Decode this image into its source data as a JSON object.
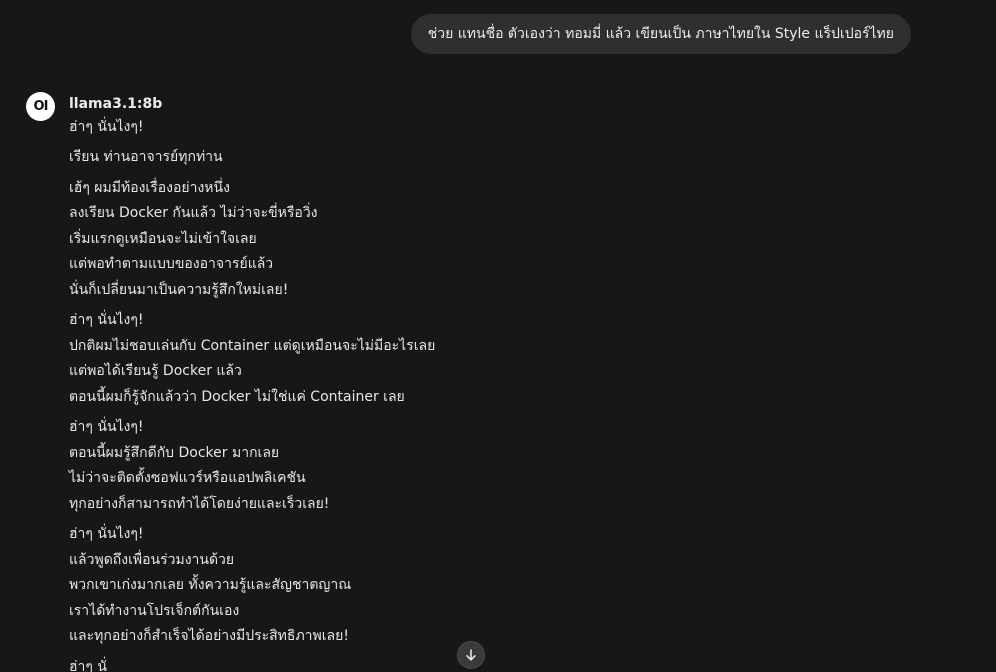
{
  "user_message": "ช่วย แทนชื่อ ตัวเองว่า ทอมมี่ แล้ว เขียนเป็น ภาษาไทยใน Style แร็ปเปอร์ไทย",
  "assistant": {
    "avatar_text": "OI",
    "model_name": "llama3.1:8b",
    "paragraphs": [
      [
        "ฮ่าๆ นั่นไงๆ!"
      ],
      [
        "เรียน ท่านอาจารย์ทุกท่าน"
      ],
      [
        "เฮ้ๆ ผมมีท้องเรื่องอย่างหนึ่ง",
        "ลงเรียน Docker กันแล้ว ไม่ว่าจะขี่หรือวิ่ง",
        "เริ่มแรกดูเหมือนจะไม่เข้าใจเลย",
        "แต่พอทำตามแบบของอาจารย์แล้ว",
        "นั่นก็เปลี่ยนมาเป็นความรู้สึกใหม่เลย!"
      ],
      [
        "ฮ่าๆ นั่นไงๆ!",
        "ปกติผมไม่ชอบเล่นกับ Container แต่ดูเหมือนจะไม่มีอะไรเลย",
        "แต่พอได้เรียนรู้ Docker แล้ว",
        "ตอนนี้ผมก็รู้จักแล้วว่า Docker ไม่ใช่แค่ Container เลย"
      ],
      [
        "ฮ่าๆ นั่นไงๆ!",
        "ตอนนี้ผมรู้สึกดีกับ Docker มากเลย",
        "ไม่ว่าจะติดตั้งซอฟแวร์หรือแอปพลิเคชัน",
        "ทุกอย่างก็สามารถทำได้โดยง่ายและเร็วเลย!"
      ],
      [
        "ฮ่าๆ นั่นไงๆ!",
        "แล้วพูดถึงเพื่อนร่วมงานด้วย",
        "พวกเขาเก่งมากเลย ทั้งความรู้และสัญชาตญาณ",
        "เราได้ทำงานโปรเจ็กต์กันเอง",
        "และทุกอย่างก็สำเร็จได้อย่างมีประสิทธิภาพเลย!"
      ],
      [
        "ฮ่าๆ นั่"
      ]
    ]
  },
  "scroll_button": {
    "icon": "arrow-down-icon"
  }
}
